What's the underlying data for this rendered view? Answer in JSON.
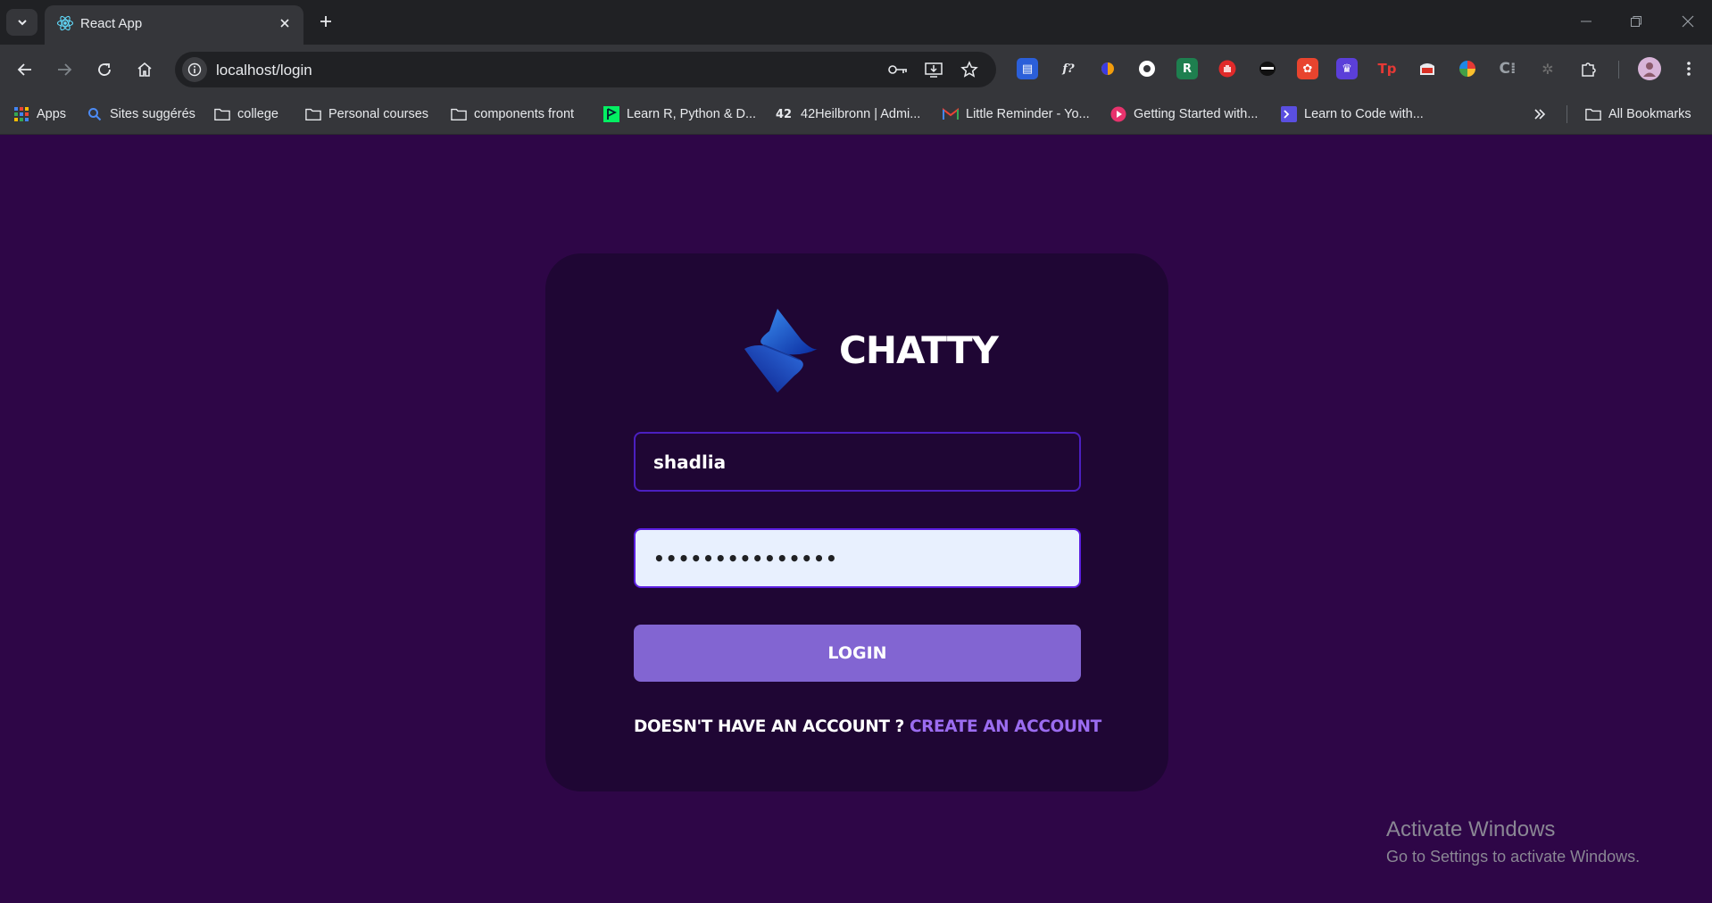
{
  "browser": {
    "tab_title": "React App",
    "url": "localhost/login",
    "bookmarks": [
      {
        "label": "Apps",
        "icon": "apps-grid-icon"
      },
      {
        "label": "Sites suggérés",
        "icon": "search-icon"
      },
      {
        "label": "college",
        "icon": "folder-icon"
      },
      {
        "label": "Personal courses",
        "icon": "folder-icon"
      },
      {
        "label": "components front",
        "icon": "folder-icon"
      },
      {
        "label": "Learn R, Python & D...",
        "icon": "datacamp-icon"
      },
      {
        "label": "42Heilbronn | Admi...",
        "icon": "42-icon"
      },
      {
        "label": "Little Reminder - Yo...",
        "icon": "gmail-icon"
      },
      {
        "label": "Getting Started with...",
        "icon": "play-icon"
      },
      {
        "label": "Learn to Code with...",
        "icon": "terminal-icon"
      }
    ],
    "all_bookmarks_label": "All Bookmarks"
  },
  "app": {
    "brand": "CHATTY",
    "username_value": "shadlia",
    "password_value": "•••••••••••••••",
    "login_label": "LOGIN",
    "signup_prompt": "DOESN'T HAVE AN ACCOUNT ? ",
    "signup_link": "CREATE AN ACCOUNT",
    "colors": {
      "background": "#2e0647",
      "card": "#1f0634",
      "button": "#8265d2",
      "link": "#9b6cf0",
      "input_border": "#4b1fc0"
    }
  },
  "os_overlay": {
    "title": "Activate Windows",
    "subtitle": "Go to Settings to activate Windows."
  }
}
